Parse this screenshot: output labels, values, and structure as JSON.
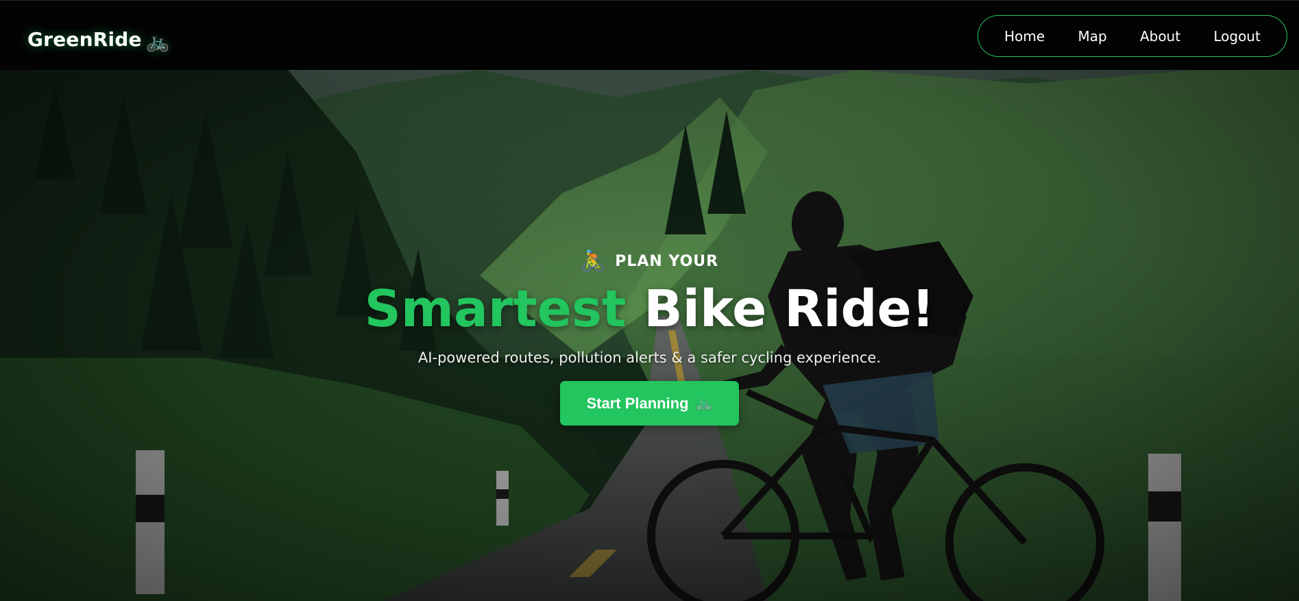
{
  "colors": {
    "accent": "#22c55e",
    "navbar_bg": "#030303",
    "text": "#ffffff"
  },
  "navbar": {
    "brand": "GreenRide",
    "brand_icon": "bicycle-icon",
    "brand_emoji": "🚲",
    "links": [
      {
        "label": "Home"
      },
      {
        "label": "Map"
      },
      {
        "label": "About"
      },
      {
        "label": "Logout"
      }
    ]
  },
  "hero": {
    "background": "cyclist-on-mountain-road-photo",
    "eyebrow_icon": "cyclist-icon",
    "eyebrow_emoji": "🚴",
    "eyebrow": "PLAN YOUR",
    "headline_accent": "Smartest",
    "headline_rest": "Bike Ride!",
    "subtitle": "AI-powered routes, pollution alerts & a safer cycling experience.",
    "cta_label": "Start Planning",
    "cta_icon": "bicycle-icon",
    "cta_emoji": "🚲"
  }
}
